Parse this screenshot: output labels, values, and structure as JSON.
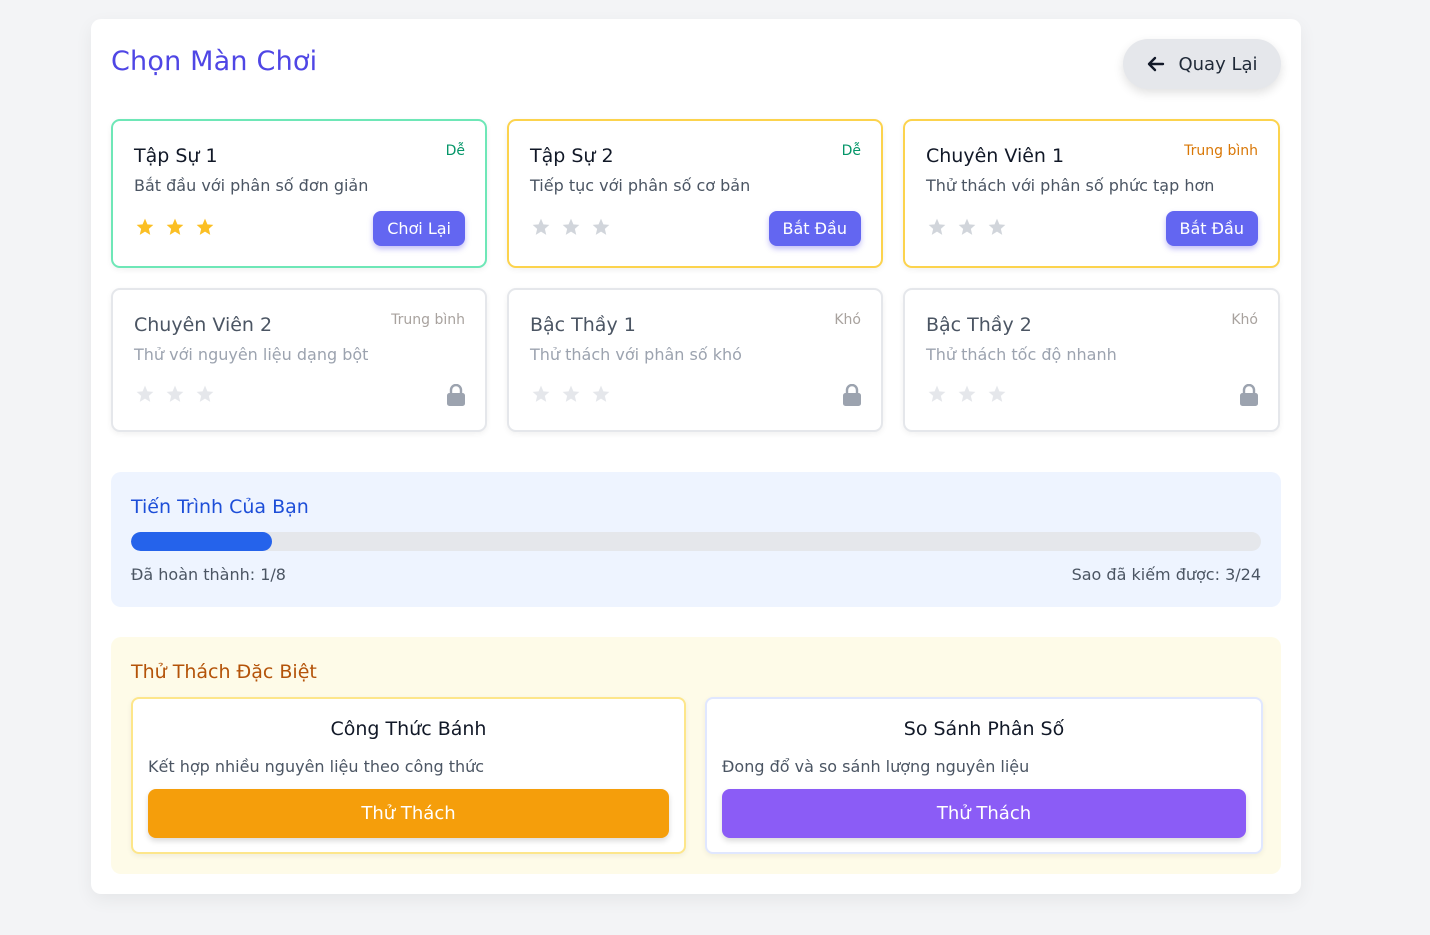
{
  "header": {
    "title": "Chọn Màn Chơi",
    "back_label": "Quay Lại",
    "back_icon": "arrow-left-icon"
  },
  "levels": [
    {
      "name": "Tập Sự 1",
      "description": "Bắt đầu với phân số đơn giản",
      "difficulty": "Dễ",
      "status": "completed",
      "stars": 3,
      "max_stars": 3,
      "button_label": "Chơi Lại"
    },
    {
      "name": "Tập Sự 2",
      "description": "Tiếp tục với phân số cơ bản",
      "difficulty": "Dễ",
      "status": "open",
      "stars": 0,
      "max_stars": 3,
      "button_label": "Bắt Đầu"
    },
    {
      "name": "Chuyên Viên 1",
      "description": "Thử thách với phân số phức tạp hơn",
      "difficulty": "Trung bình",
      "status": "open",
      "stars": 0,
      "max_stars": 3,
      "button_label": "Bắt Đầu"
    },
    {
      "name": "Chuyên Viên 2",
      "description": "Thử với nguyên liệu dạng bột",
      "difficulty": "Trung bình",
      "status": "locked",
      "stars": 0,
      "max_stars": 3,
      "icon": "lock-icon"
    },
    {
      "name": "Bậc Thầy 1",
      "description": "Thử thách với phân số khó",
      "difficulty": "Khó",
      "status": "locked",
      "stars": 0,
      "max_stars": 3,
      "icon": "lock-icon"
    },
    {
      "name": "Bậc Thầy 2",
      "description": "Thử thách tốc độ nhanh",
      "difficulty": "Khó",
      "status": "locked",
      "stars": 0,
      "max_stars": 3,
      "icon": "lock-icon"
    }
  ],
  "progress": {
    "title": "Tiến Trình Của Bạn",
    "completed_text": "Đã hoàn thành: 1/8",
    "stars_text": "Sao đã kiếm được: 3/24",
    "completed": 1,
    "total": 8,
    "fraction": 0.125
  },
  "special": {
    "title": "Thử Thách Đặc Biệt",
    "challenges": [
      {
        "name": "Công Thức Bánh",
        "description": "Kết hợp nhiều nguyên liệu theo công thức",
        "button_label": "Thử Thách",
        "color": "#f59e0b"
      },
      {
        "name": "So Sánh Phân Số",
        "description": "Đong đổ và so sánh lượng nguyên liệu",
        "button_label": "Thử Thách",
        "color": "#8b5cf6"
      }
    ]
  },
  "colors": {
    "accent": "#4f46e5",
    "button": "#6366f1",
    "star_on": "#fbbf24",
    "progress": "#2563eb"
  }
}
